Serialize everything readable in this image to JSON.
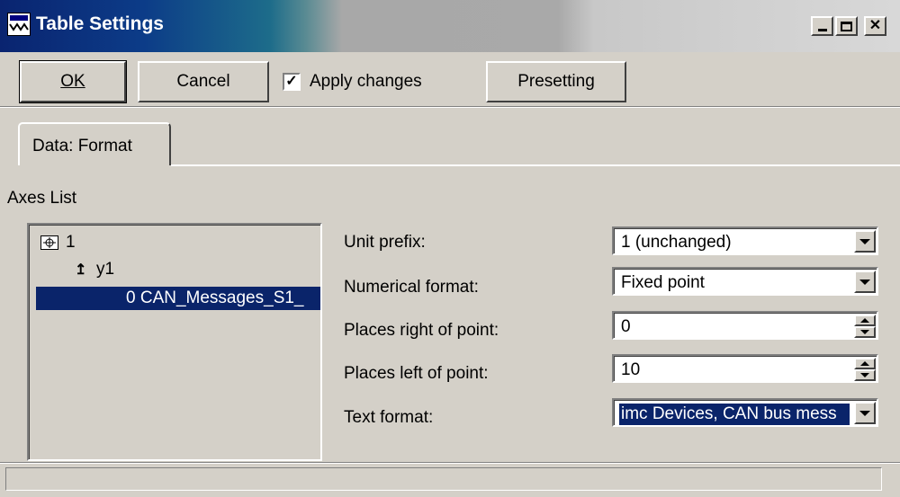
{
  "window": {
    "title": "Table Settings",
    "icon": "table-settings-icon",
    "controls": [
      "minimize",
      "maximize",
      "close"
    ]
  },
  "toolbar": {
    "ok_label": "OK",
    "cancel_label": "Cancel",
    "apply_label": "Apply changes",
    "apply_checked": true,
    "presetting_label": "Presetting"
  },
  "tab": {
    "label": "Data: Format"
  },
  "axes": {
    "label": "Axes List",
    "tree": [
      {
        "text": "1",
        "icon": "axis-grid-icon",
        "level": 0,
        "selected": false
      },
      {
        "text": "y1",
        "icon": "y-axis-icon",
        "level": 1,
        "selected": false
      },
      {
        "text": "0  CAN_Messages_S1_",
        "icon": "channel-icon",
        "level": 2,
        "selected": true
      }
    ]
  },
  "form": {
    "unit_prefix": {
      "label": "Unit prefix:",
      "value": "1 (unchanged)"
    },
    "numerical_format": {
      "label": "Numerical format:",
      "value": "Fixed point"
    },
    "places_right": {
      "label": "Places right of point:",
      "value": "0"
    },
    "places_left": {
      "label": "Places left of point:",
      "value": "10"
    },
    "text_format": {
      "label": "Text format:",
      "value": "imc Devices, CAN bus mess"
    }
  },
  "status": {
    "text": ""
  },
  "colors": {
    "selection": "#0a246a",
    "face": "#d4d0c8",
    "title_start": "#0a2470"
  }
}
